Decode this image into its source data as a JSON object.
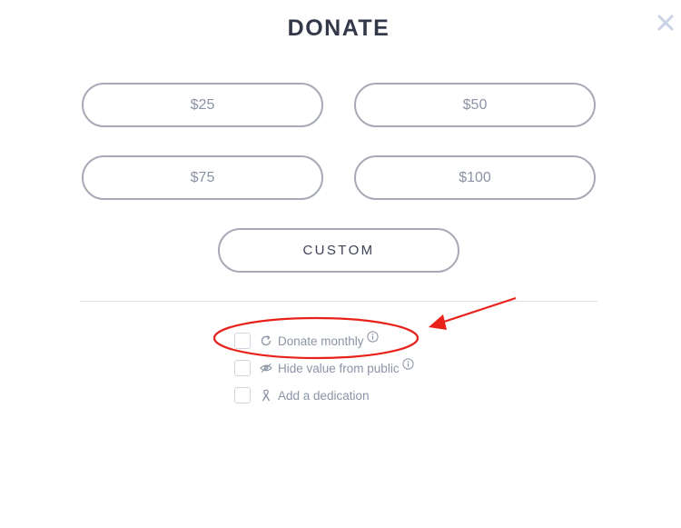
{
  "modal": {
    "title": "DONATE",
    "amounts": [
      "$25",
      "$50",
      "$75",
      "$100"
    ],
    "custom_label": "CUSTOM"
  },
  "options": [
    {
      "label": "Donate monthly",
      "icon": "refresh-icon",
      "has_info": true,
      "checked": false
    },
    {
      "label": "Hide value from public",
      "icon": "eye-off-icon",
      "has_info": true,
      "checked": false
    },
    {
      "label": "Add a dedication",
      "icon": "ribbon-icon",
      "has_info": false,
      "checked": false
    }
  ],
  "annotation": {
    "color": "#e8221b"
  },
  "colors": {
    "title": "#34394a",
    "button_border": "#a6a9b6",
    "button_text": "#8c93a6",
    "custom_text": "#3e4354",
    "divider": "#dbe2e7",
    "option_text": "#8b93a6",
    "close": "#c9d2e6"
  }
}
